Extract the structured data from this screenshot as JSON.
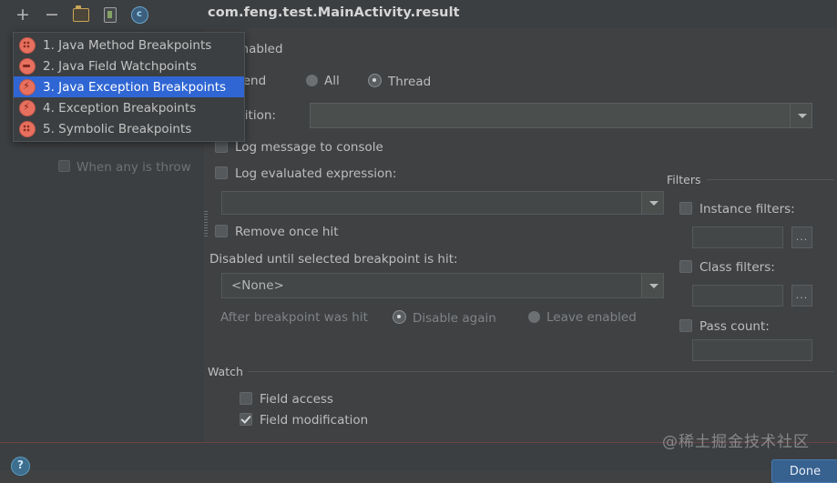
{
  "toolbar": {
    "add_label": "+",
    "remove_label": "−",
    "folder_icon": "folder-icon",
    "document_icon": "copy-breakpoint-icon",
    "circle_icon": "c",
    "title": "com.feng.test.MainActivity.result"
  },
  "menu": {
    "items": [
      {
        "label": "1. Java Method Breakpoints",
        "icon": "method-breakpoint-icon",
        "selected": false
      },
      {
        "label": "2. Java Field Watchpoints",
        "icon": "field-watchpoint-icon",
        "selected": false
      },
      {
        "label": "3. Java Exception Breakpoints",
        "icon": "exception-breakpoint-icon",
        "selected": true
      },
      {
        "label": "4. Exception Breakpoints",
        "icon": "exception-breakpoint-icon",
        "selected": false
      },
      {
        "label": "5. Symbolic Breakpoints",
        "icon": "symbolic-breakpoint-icon",
        "selected": false
      }
    ]
  },
  "left_panel": {
    "ghost_item": "When any is throw"
  },
  "main": {
    "enabled_label": "Enabled",
    "suspend_label": "Suspend",
    "suspend_all": "All",
    "suspend_thread": "Thread",
    "suspend_selected": "Thread",
    "condition_label": "Condition:",
    "condition_value": "",
    "log_message_label": "Log message to console",
    "log_message_checked": false,
    "log_expression_label": "Log evaluated expression:",
    "log_expression_checked": false,
    "log_expression_value": "",
    "remove_once_hit_label": "Remove once hit",
    "remove_once_hit_checked": false,
    "disabled_until_label": "Disabled until selected breakpoint is hit:",
    "disabled_until_value": "<None>",
    "after_hit_label": "After breakpoint was hit",
    "after_hit_disable": "Disable again",
    "after_hit_leave": "Leave enabled",
    "after_hit_selected": "Disable again"
  },
  "filters": {
    "title": "Filters",
    "instance_label": "Instance filters:",
    "instance_checked": false,
    "instance_value": "",
    "instance_browse": "...",
    "class_label": "Class filters:",
    "class_checked": false,
    "class_value": "",
    "class_browse": "...",
    "pass_count_label": "Pass count:",
    "pass_count_checked": false,
    "pass_count_value": ""
  },
  "watch": {
    "title": "Watch",
    "field_access_label": "Field access",
    "field_access_checked": false,
    "field_modification_label": "Field modification",
    "field_modification_checked": true
  },
  "bottom": {
    "help_icon": "help-icon",
    "done_label": "Done",
    "watermark": "@稀土掘金技术社区"
  },
  "colors": {
    "background": "#3f4143",
    "panel": "#3c3f41",
    "field": "#4a4f4e",
    "accent_selection": "#2f66d4",
    "breakpoint_red": "#e8705f",
    "button_blue": "#37618f",
    "separator_red": "#6b4346"
  }
}
